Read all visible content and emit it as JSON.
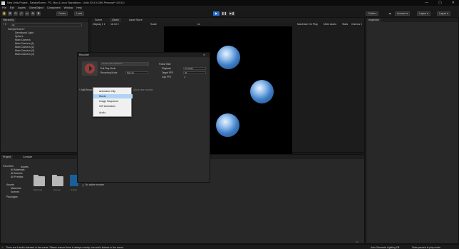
{
  "window": {
    "title": "New Unity Project - SampleScene - PC, Mac & Linux Standalone - Unity 2019.4.28f1 Personal* <DX11>",
    "controls": [
      "—",
      "▢",
      "✕"
    ]
  },
  "menu": [
    "File",
    "Edit",
    "Assets",
    "GameObject",
    "Component",
    "Window",
    "Help"
  ],
  "toolbar": {
    "center_label": "Center",
    "local_label": "Local",
    "collab_label": "Collab ▾",
    "account_label": "Account ▾",
    "layers_label": "Layers ▾",
    "layout_label": "Layout ▾"
  },
  "hierarchy": {
    "tab": "Hierarchy",
    "add_label": "+ ▾",
    "search_placeholder": "All",
    "scene": "SampleScene*",
    "items": [
      "Directional Light",
      "Sphere",
      "Main Camera",
      "Main Camera (1)",
      "Main Camera (2)",
      "Main Camera (3)",
      "Main Camera (4)"
    ]
  },
  "scene_tabs": [
    "Scene",
    "Game",
    "Asset Store"
  ],
  "game_toolbar": {
    "display": "Display 1 ▾",
    "aspect": "16:10 ▾",
    "scale_label": "Scale",
    "scale_value": "1x",
    "maximize": "Maximize On Play",
    "mute": "Mute Audio",
    "stats": "Stats",
    "gizmos": "Gizmos ▾"
  },
  "inspector": {
    "tab": "Inspector"
  },
  "recorder": {
    "title": "Recorder",
    "start_button": "START RECORDING",
    "exit_play_mode_label": "Exit Play Mode",
    "recording_mode_label": "Recording Mode",
    "recording_mode_value": "Manual",
    "frame_rate_title": "Frame Rate",
    "playback_label": "Playback",
    "playback_value": "Constant",
    "target_fps_label": "Target FPS",
    "target_fps_value": "30",
    "cap_fps_label": "Cap FPS",
    "add_recorder": "+ Add Recorder",
    "hint_text": "Add a new recorder",
    "no_active": "No active recorder"
  },
  "dropdown": {
    "items": [
      "Animation Clip",
      "Movie",
      "Image Sequence",
      "GIF Animation",
      "Audio"
    ],
    "selected_index": 1
  },
  "project": {
    "tabs": [
      "Project",
      "Console"
    ],
    "favorites_label": "Favorites",
    "favorites": [
      "All Materials",
      "All Models",
      "All Prefabs"
    ],
    "assets_label": "Assets",
    "assets_children": [
      "Materials",
      "Scenes"
    ],
    "packages_label": "Packages",
    "breadcrumb": "Assets",
    "files": [
      "Materials",
      "Scenes",
      "Unlock"
    ],
    "file_count": "14"
  },
  "status": {
    "message": "There are 6 audio listeners in the scene. Please ensure there is always exactly one audio listener in the scene.",
    "lighting": "Auto Generate Lighting Off",
    "play_mode": "Stats paused in play mode"
  },
  "colors": {
    "accent": "#2b6fd1",
    "selection": "#aed3f5",
    "record_red": "#9a3b3b"
  }
}
